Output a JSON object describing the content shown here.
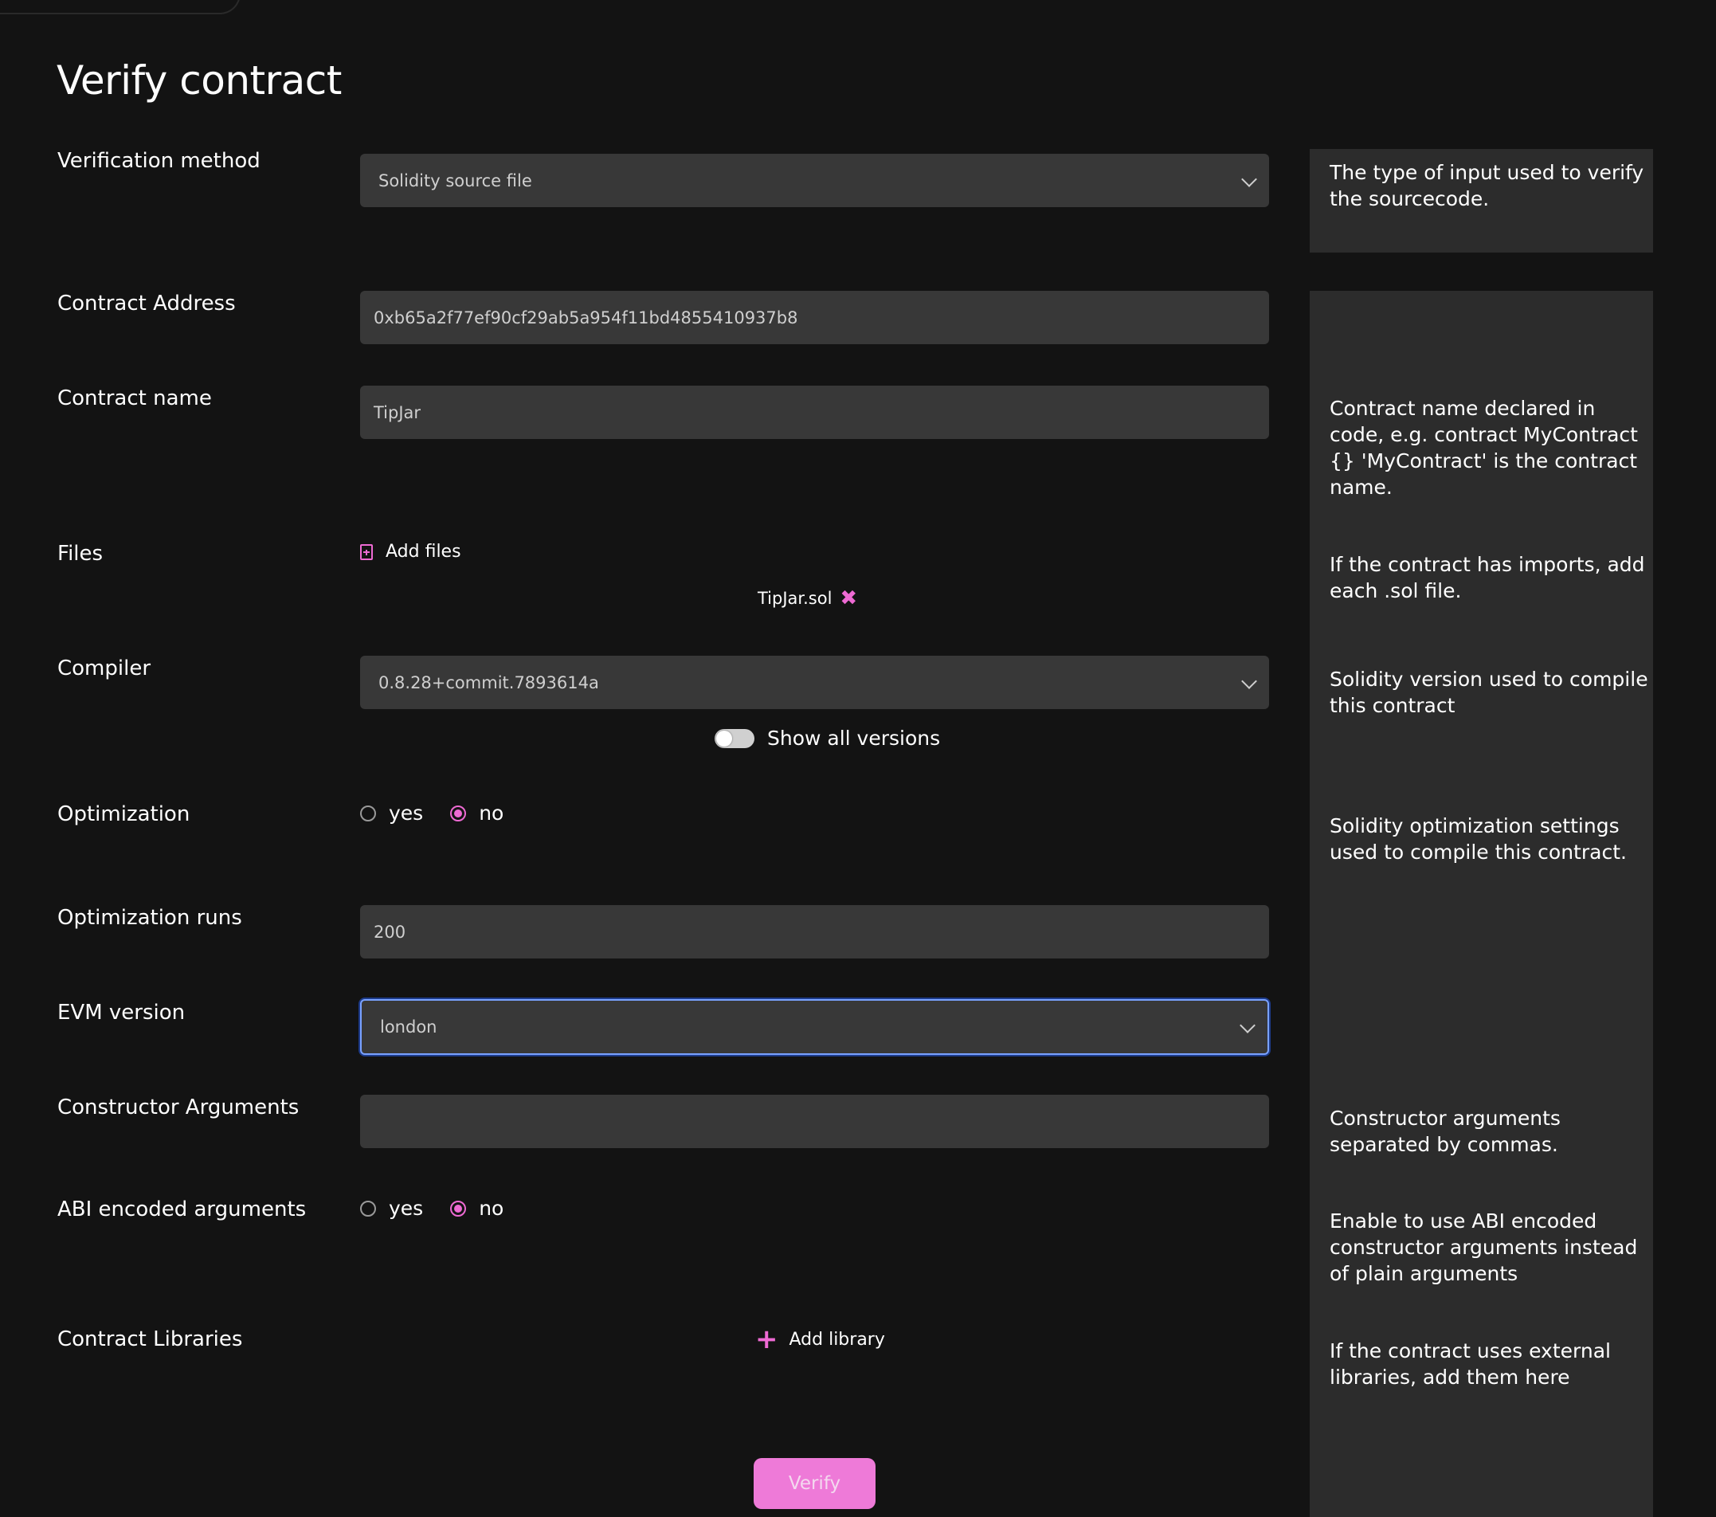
{
  "page": {
    "title": "Verify contract"
  },
  "fields": {
    "verification_method": {
      "label": "Verification method",
      "value": "Solidity source file",
      "help": "The type of input used to verify the sourcecode."
    },
    "contract_address": {
      "label": "Contract Address",
      "value": "0xb65a2f77ef90cf29ab5a954f11bd4855410937b8"
    },
    "contract_name": {
      "label": "Contract name",
      "value": "TipJar",
      "help": "Contract name declared in code, e.g. contract MyContract {} 'MyContract' is the contract name."
    },
    "files": {
      "label": "Files",
      "add_label": "Add files",
      "file_name": "TipJar.sol",
      "help": "If the contract has imports, add each .sol file."
    },
    "compiler": {
      "label": "Compiler",
      "value": "0.8.28+commit.7893614a",
      "toggle_label": "Show all versions",
      "help": "Solidity version used to compile this contract"
    },
    "optimization": {
      "label": "Optimization",
      "yes_label": "yes",
      "no_label": "no",
      "selected": "no",
      "help": "Solidity optimization settings used to compile this contract."
    },
    "optimization_runs": {
      "label": "Optimization runs",
      "value": "200"
    },
    "evm_version": {
      "label": "EVM version",
      "value": "london"
    },
    "constructor_arguments": {
      "label": "Constructor Arguments",
      "value": "",
      "help": "Constructor arguments separated by commas."
    },
    "abi_encoded": {
      "label": "ABI encoded arguments",
      "yes_label": "yes",
      "no_label": "no",
      "selected": "no",
      "help": "Enable to use ABI encoded constructor arguments instead of plain arguments"
    },
    "libraries": {
      "label": "Contract Libraries",
      "add_label": "Add library",
      "help": "If the contract uses external libraries, add them here"
    }
  },
  "actions": {
    "verify_label": "Verify"
  },
  "colors": {
    "background": "#131313",
    "input_background": "#383838",
    "panel_background": "#2c2c2c",
    "accent": "#ee6ad3",
    "focus": "#7aa2ff"
  },
  "icons": {
    "add_files": "file-plus-icon",
    "remove_file": "close-icon",
    "add_library": "plus-icon",
    "select_arrow": "chevron-down-icon"
  }
}
